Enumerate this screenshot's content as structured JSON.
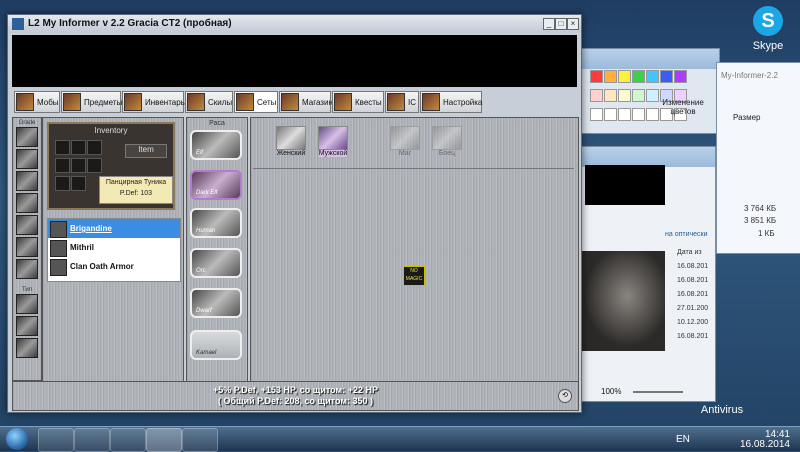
{
  "desktop": {
    "skype_label": "Skype",
    "antivirus_label": "Antivirus"
  },
  "paint": {
    "change_colors_label": "Изменение цветов"
  },
  "explorer": {
    "title": "My-Informer-2.2",
    "size_header": "Размер",
    "sizes": [
      "3 764 КБ",
      "3 851 КБ",
      "1 КБ"
    ]
  },
  "viewer": {
    "left_label": "на оптически",
    "date_header": "Дата из",
    "dates": [
      "16.08.201",
      "16.08.201",
      "16.08.201",
      "27.01.200",
      "10.12.200",
      "16.08.201"
    ],
    "zoom": "100%"
  },
  "taskbar": {
    "lang": "EN",
    "time": "14:41",
    "date": "16.08.2014"
  },
  "app": {
    "title": "L2 My Informer v 2.2 Gracia CT2 (пробная)",
    "tabs": [
      {
        "label": "Мобы"
      },
      {
        "label": "Предметы"
      },
      {
        "label": "Инвентарь"
      },
      {
        "label": "Скилы"
      },
      {
        "label": "Сеты"
      },
      {
        "label": "Магазин"
      },
      {
        "label": "Квесты"
      },
      {
        "label": "IC"
      },
      {
        "label": "Настройка"
      }
    ],
    "left_group_top": "Grade",
    "left_group_bottom": "Тип",
    "inventory": {
      "title": "Inventory",
      "item_tab": "Item",
      "tooltip_name": "Панцирная Туника",
      "tooltip_stat": "P.Def: 103"
    },
    "items": [
      {
        "name": "Brigandine"
      },
      {
        "name": "Mithril"
      },
      {
        "name": "Clan Oath Armor"
      }
    ],
    "race_header": "Раса",
    "races": [
      {
        "label": "Elf"
      },
      {
        "label": "Dark Elf"
      },
      {
        "label": "Human"
      },
      {
        "label": "Orc"
      },
      {
        "label": "Dwarf"
      },
      {
        "label": "Kamael"
      }
    ],
    "filters": [
      {
        "label": "Женский"
      },
      {
        "label": "Мужской"
      },
      {
        "label": "Маг"
      },
      {
        "label": "Боец"
      }
    ],
    "no_magic": "NO MAGIC",
    "stats_line1": "+5% P.Def, +153 HP, со щитом: +22 HP",
    "stats_line2": "( Общий P.Def: 208, со щитом: 350 )"
  },
  "colors": {
    "selected_row": "#3a8de0",
    "selected_race_border": "#b57bd0",
    "banner": "#000000"
  }
}
